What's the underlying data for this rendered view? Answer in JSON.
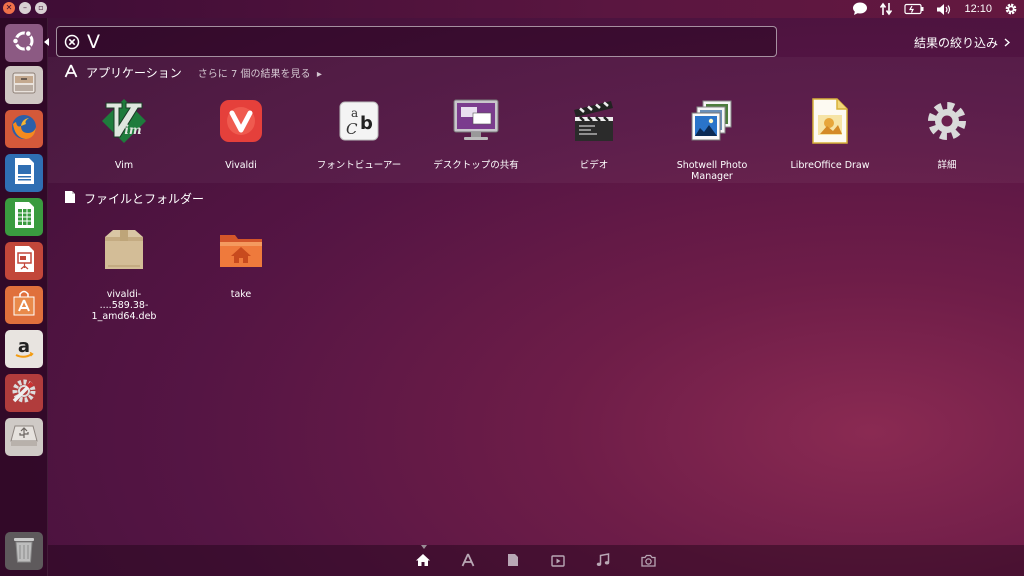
{
  "top_panel": {
    "window_buttons": [
      "close",
      "minimize",
      "maximize"
    ],
    "indicators": [
      {
        "icon": "messaging-icon"
      },
      {
        "icon": "network-icon"
      },
      {
        "icon": "battery-icon"
      },
      {
        "icon": "volume-icon"
      }
    ],
    "clock": "12:10",
    "settings_icon": "gear-icon"
  },
  "launcher": {
    "items": [
      {
        "name": "dash-home",
        "icon": "ubuntu-logo-icon"
      },
      {
        "name": "files",
        "icon": "file-cabinet-icon"
      },
      {
        "name": "firefox",
        "icon": "firefox-icon"
      },
      {
        "name": "libreoffice-writer",
        "icon": "writer-icon"
      },
      {
        "name": "libreoffice-calc",
        "icon": "calc-icon"
      },
      {
        "name": "libreoffice-impress",
        "icon": "impress-icon"
      },
      {
        "name": "software-center",
        "icon": "shopping-bag-icon"
      },
      {
        "name": "amazon",
        "icon": "amazon-icon"
      },
      {
        "name": "system-settings",
        "icon": "wrench-gear-icon"
      },
      {
        "name": "usb-drive",
        "icon": "usb-drive-icon"
      },
      {
        "name": "trash",
        "icon": "trash-icon"
      }
    ]
  },
  "search": {
    "value": "V",
    "clear_icon": "clear-circle-icon"
  },
  "filter": {
    "label": "結果の絞り込み",
    "icon": "chevron-right-icon"
  },
  "categories": {
    "applications": {
      "title": "アプリケーション",
      "more": "さらに 7 個の結果を見る",
      "icon": "applications-icon",
      "items": [
        {
          "label": "Vim",
          "icon": "vim-icon"
        },
        {
          "label": "Vivaldi",
          "icon": "vivaldi-icon"
        },
        {
          "label": "フォントビューアー",
          "icon": "font-viewer-icon"
        },
        {
          "label": "デスクトップの共有",
          "icon": "desktop-sharing-icon"
        },
        {
          "label": "ビデオ",
          "icon": "clapperboard-icon"
        },
        {
          "label": "Shotwell Photo Manager",
          "icon": "photos-icon"
        },
        {
          "label": "LibreOffice Draw",
          "icon": "draw-icon"
        },
        {
          "label": "詳細",
          "icon": "gear-icon"
        }
      ]
    },
    "files": {
      "title": "ファイルとフォルダー",
      "icon": "file-icon",
      "items": [
        {
          "label_line1": "vivaldi-",
          "label_line2": "....589.38-1_amd64.deb",
          "icon": "package-icon"
        },
        {
          "label": "take",
          "icon": "home-folder-icon"
        }
      ]
    }
  },
  "lenses": [
    {
      "name": "home",
      "icon": "home-icon",
      "active": true
    },
    {
      "name": "applications",
      "icon": "applications-icon"
    },
    {
      "name": "files",
      "icon": "file-icon"
    },
    {
      "name": "video",
      "icon": "video-icon"
    },
    {
      "name": "music",
      "icon": "music-note-icon"
    },
    {
      "name": "photos",
      "icon": "camera-icon"
    }
  ],
  "colors": {
    "accent": "#e95420",
    "background": "#5a1540"
  }
}
